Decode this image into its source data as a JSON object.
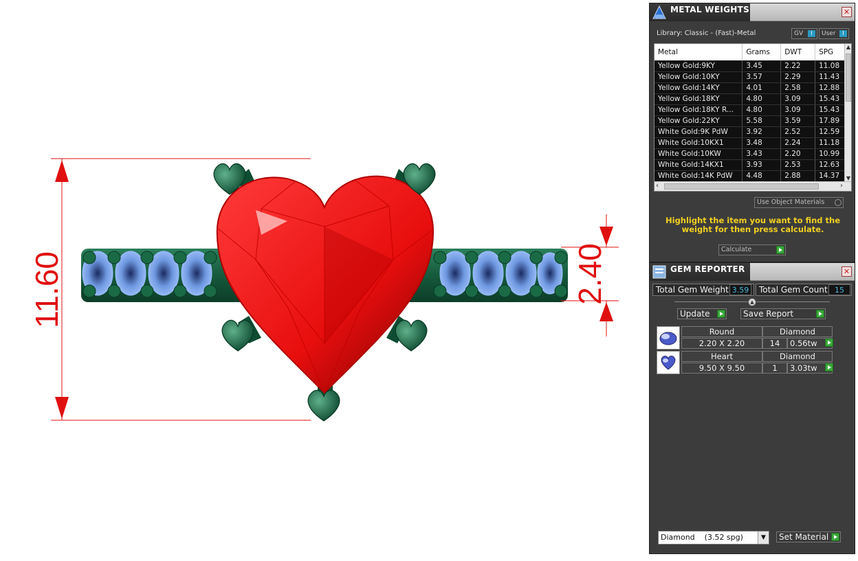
{
  "viewport": {
    "dimension_height": "11.60",
    "dimension_width": "2.40",
    "colors": {
      "dimension": "#e01010",
      "stone": "#ff2222",
      "metal": "#1f6a4a",
      "side_stones": "#8ab4f0"
    }
  },
  "metal_weights": {
    "title": "METAL WEIGHTS",
    "library": "Library: Classic - (Fast)-Metal",
    "toggle_gv": "GV",
    "toggle_user": "User",
    "columns": [
      "Metal",
      "Grams",
      "DWT",
      "SPG"
    ],
    "rows": [
      [
        "Yellow Gold:9KY",
        "3.45",
        "2.22",
        "11.08"
      ],
      [
        "Yellow Gold:10KY",
        "3.57",
        "2.29",
        "11.43"
      ],
      [
        "Yellow Gold:14KY",
        "4.01",
        "2.58",
        "12.88"
      ],
      [
        "Yellow Gold:18KY",
        "4.80",
        "3.09",
        "15.43"
      ],
      [
        "Yellow Gold:18KY R...",
        "4.80",
        "3.09",
        "15.43"
      ],
      [
        "Yellow Gold:22KY",
        "5.58",
        "3.59",
        "17.89"
      ],
      [
        "White Gold:9K PdW",
        "3.92",
        "2.52",
        "12.59"
      ],
      [
        "White Gold:10KX1",
        "3.48",
        "2.24",
        "11.18"
      ],
      [
        "White Gold:10KW",
        "3.43",
        "2.20",
        "10.99"
      ],
      [
        "White Gold:14KX1",
        "3.93",
        "2.53",
        "12.63"
      ],
      [
        "White Gold:14K PdW",
        "4.48",
        "2.88",
        "14.37"
      ]
    ],
    "use_object_materials": "Use Object Materials",
    "hint": "Highlight the item you want to find the weight for then press calculate.",
    "calculate": "Calculate"
  },
  "gem_reporter": {
    "title": "GEM REPORTER",
    "total_weight_label": "Total Gem Weight",
    "total_weight_value": "3.59",
    "total_count_label": "Total Gem Count",
    "total_count_value": "15",
    "update": "Update",
    "save_report": "Save Report",
    "gems": [
      {
        "shape": "Round",
        "material": "Diamond",
        "size": "2.20 X 2.20",
        "count": "14",
        "weight": "0.56tw"
      },
      {
        "shape": "Heart",
        "material": "Diamond",
        "size": "9.50 X 9.50",
        "count": "1",
        "weight": "3.03tw"
      }
    ],
    "material_select": "Diamond    (3.52 spg)",
    "set_material": "Set Material"
  }
}
